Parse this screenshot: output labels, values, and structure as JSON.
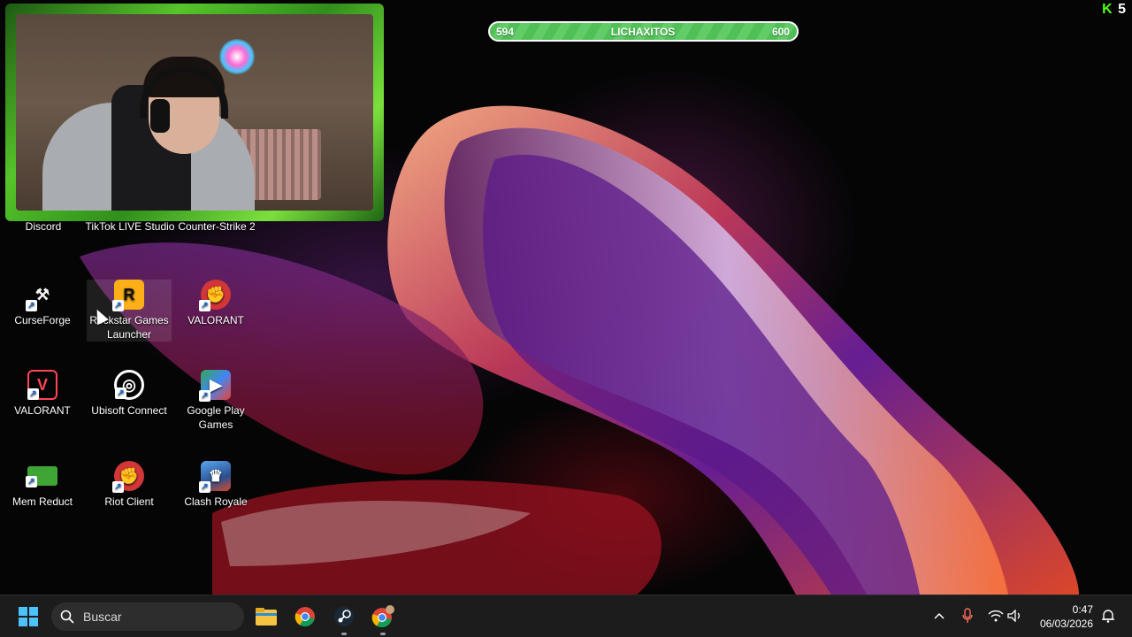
{
  "overlay": {
    "health": {
      "current": "594",
      "name": "LICHAXITOS",
      "max": "600",
      "fill_fraction": 0.99
    },
    "logo": {
      "k": "K",
      "num": "5"
    }
  },
  "desktop": {
    "top_labels": [
      "Discord",
      "TikTok LIVE Studio",
      "Counter-Strike 2"
    ],
    "icons": [
      {
        "label": "CurseForge",
        "icon": "curseforge-icon",
        "color": "#f5f5f5"
      },
      {
        "label": "Rockstar Games Launcher",
        "icon": "rockstar-icon",
        "color": "#fcaf17"
      },
      {
        "label": "VALORANT",
        "icon": "riot-icon",
        "color": "#d13639"
      },
      {
        "label": "VALORANT",
        "icon": "valorant-icon",
        "color": "#fd4556"
      },
      {
        "label": "Ubisoft Connect",
        "icon": "ubisoft-icon",
        "color": "#ffffff"
      },
      {
        "label": "Google Play Games",
        "icon": "google-play-games-icon",
        "color": "#34a853"
      },
      {
        "label": "Mem Reduct",
        "icon": "mem-reduct-icon",
        "color": "#3fa535"
      },
      {
        "label": "Riot Client",
        "icon": "riot-client-icon",
        "color": "#d13639"
      },
      {
        "label": "Clash Royale",
        "icon": "clash-royale-icon",
        "color": "#4a90d9"
      }
    ]
  },
  "taskbar": {
    "search_placeholder": "Buscar",
    "time": "0:47",
    "date": "06/03/2026",
    "apps": [
      "file-explorer-icon",
      "chrome-icon",
      "steam-icon",
      "chrome-profile-icon"
    ]
  }
}
